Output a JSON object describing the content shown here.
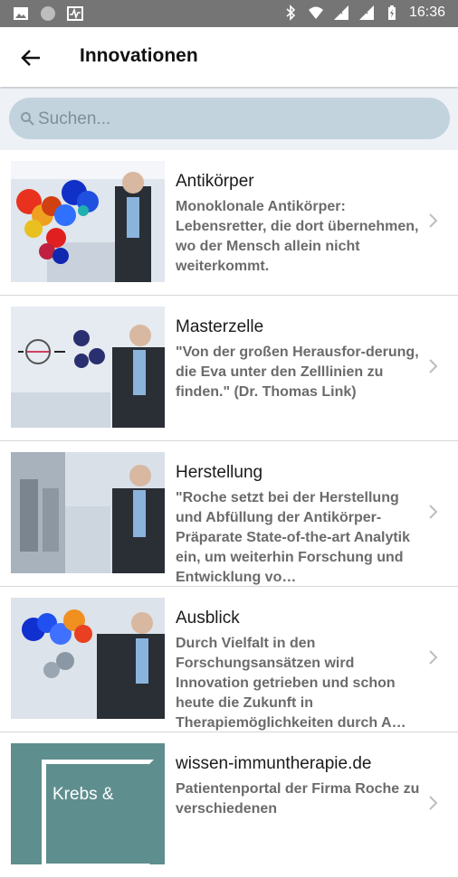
{
  "status_bar": {
    "time": "16:36"
  },
  "app_bar": {
    "title": "Innovationen"
  },
  "search": {
    "placeholder": "Suchen..."
  },
  "items": [
    {
      "title": "Antikörper",
      "desc": "Monoklonale Antikörper: Lebensretter, die dort übernehmen, wo der Mensch allein nicht weiterkommt."
    },
    {
      "title": "Masterzelle",
      "desc": "\"Von der großen Herausfor-derung, die Eva unter den Zelllinien zu finden.\" (Dr. Thomas Link)"
    },
    {
      "title": "Herstellung",
      "desc": "\"Roche setzt bei der Herstellung und Abfüllung der Antikörper-Präparate State-of-the-art Analytik ein, um weiterhin Forschung und Entwicklung vo…"
    },
    {
      "title": "Ausblick",
      "desc": "Durch Vielfalt in den Forschungsansätzen wird Innovation getrieben und schon heute die Zukunft in Therapiemöglichkeiten durch A…"
    },
    {
      "title": "wissen-immuntherapie.de",
      "desc": "Patientenportal der Firma Roche zu verschiedenen",
      "thumb_text": "Krebs &"
    }
  ],
  "colors": {
    "status_bar": "#757575",
    "search_bg": "#c3d3de",
    "page_bg": "#eef1f6"
  }
}
